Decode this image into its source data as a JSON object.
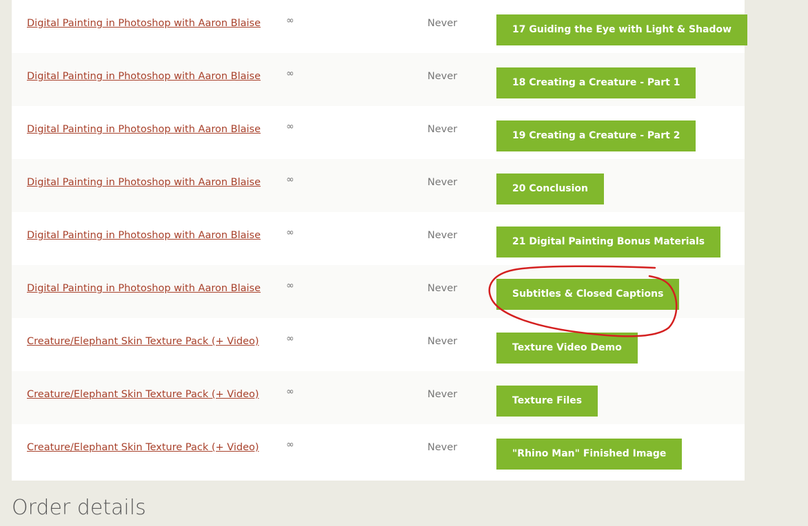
{
  "downloads": [
    {
      "product": "Digital Painting in Photoshop with Aaron Blaise",
      "remaining": "∞",
      "expires": "Never",
      "file": "17 Guiding the Eye with Light & Shadow"
    },
    {
      "product": "Digital Painting in Photoshop with Aaron Blaise",
      "remaining": "∞",
      "expires": "Never",
      "file": "18 Creating a Creature - Part 1"
    },
    {
      "product": "Digital Painting in Photoshop with Aaron Blaise",
      "remaining": "∞",
      "expires": "Never",
      "file": "19 Creating a Creature - Part 2"
    },
    {
      "product": "Digital Painting in Photoshop with Aaron Blaise",
      "remaining": "∞",
      "expires": "Never",
      "file": "20 Conclusion"
    },
    {
      "product": "Digital Painting in Photoshop with Aaron Blaise",
      "remaining": "∞",
      "expires": "Never",
      "file": "21 Digital Painting Bonus Materials"
    },
    {
      "product": "Digital Painting in Photoshop with Aaron Blaise",
      "remaining": "∞",
      "expires": "Never",
      "file": "Subtitles & Closed Captions"
    },
    {
      "product": "Creature/Elephant Skin Texture Pack (+ Video)",
      "remaining": "∞",
      "expires": "Never",
      "file": "Texture Video Demo"
    },
    {
      "product": "Creature/Elephant Skin Texture Pack (+ Video)",
      "remaining": "∞",
      "expires": "Never",
      "file": "Texture Files"
    },
    {
      "product": "Creature/Elephant Skin Texture Pack (+ Video)",
      "remaining": "∞",
      "expires": "Never",
      "file": "\"Rhino Man\" Finished Image"
    }
  ],
  "section_heading": "Order details",
  "colors": {
    "button": "#81b82d",
    "link": "#a8412b",
    "annotation": "#d42020"
  }
}
